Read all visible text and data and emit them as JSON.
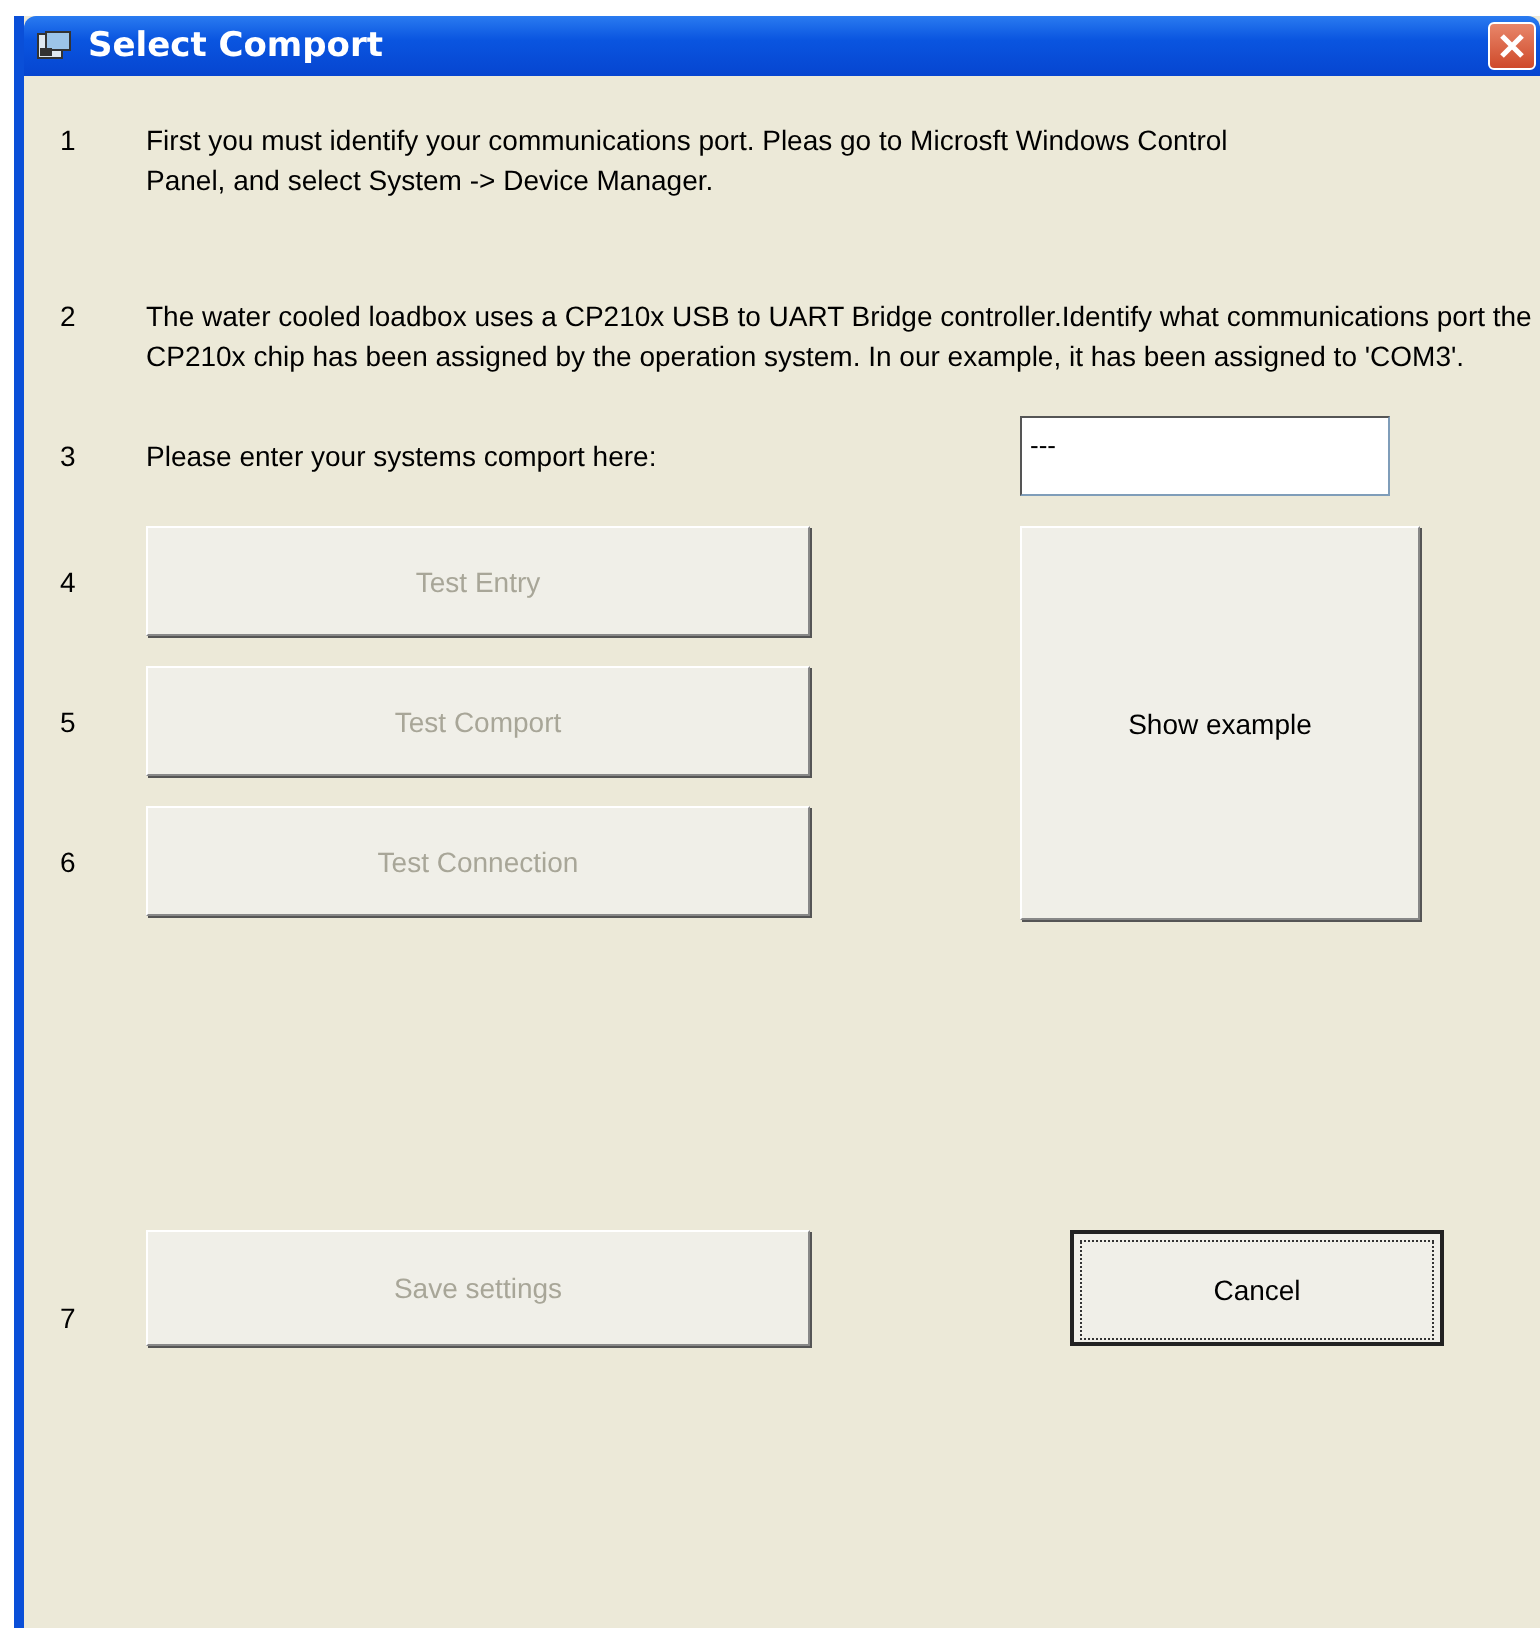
{
  "window": {
    "title": "Select Comport"
  },
  "steps": [
    {
      "number": "1",
      "text": "First you must identify your communications port. Pleas go to Microsft Windows Control Panel, and select  System -> Device Manager."
    },
    {
      "number": "2",
      "text": "The water cooled loadbox uses a CP210x USB to UART Bridge controller.Identify what communications port the CP210x chip has been assigned by the operation system. In our example, it has been assigned to 'COM3'."
    }
  ],
  "comport": {
    "number": "3",
    "label": "Please enter your systems comport here:",
    "value": "---"
  },
  "tests": [
    {
      "number": "4",
      "label": "Test Entry",
      "disabled": true
    },
    {
      "number": "5",
      "label": "Test Comport",
      "disabled": true
    },
    {
      "number": "6",
      "label": "Test Connection",
      "disabled": true
    }
  ],
  "example_button": {
    "label": "Show example",
    "disabled": false
  },
  "save": {
    "number": "7",
    "label": "Save settings",
    "disabled": true
  },
  "cancel": {
    "label": "Cancel",
    "disabled": false,
    "focused": true
  }
}
